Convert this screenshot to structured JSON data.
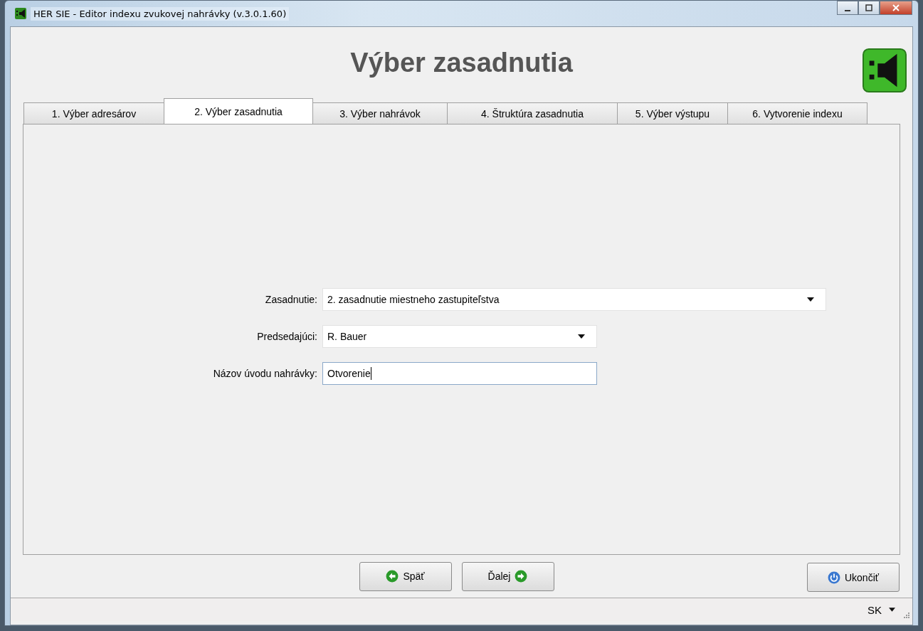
{
  "window": {
    "title": "HER SIE - Editor indexu zvukovej nahrávky (v.3.0.1.60)"
  },
  "heading": "Výber zasadnutia",
  "tabs": [
    {
      "label": "1. Výber adresárov",
      "selected": false
    },
    {
      "label": "2. Výber zasadnutia",
      "selected": true
    },
    {
      "label": "3. Výber nahrávok",
      "selected": false
    },
    {
      "label": "4. Štruktúra zasadnutia",
      "selected": false
    },
    {
      "label": "5. Výber výstupu",
      "selected": false
    },
    {
      "label": "6. Vytvorenie indexu",
      "selected": false
    }
  ],
  "fields": [
    {
      "label": "Zasadnutie:",
      "value": "2. zasadnutie miestneho zastupiteľstva",
      "kind": "combo",
      "focused": false
    },
    {
      "label": "Predsedajúci:",
      "value": "R. Bauer",
      "kind": "combo",
      "focused": false
    },
    {
      "label": "Názov úvodu nahrávky:",
      "value": "Otvorenie",
      "kind": "text",
      "focused": true
    }
  ],
  "buttons": [
    {
      "label": "Späť",
      "kind": "back"
    },
    {
      "label": "Ďalej",
      "kind": "next"
    },
    {
      "label": "Ukončiť",
      "kind": "exit"
    }
  ],
  "status_bar": {
    "language": "SK"
  }
}
